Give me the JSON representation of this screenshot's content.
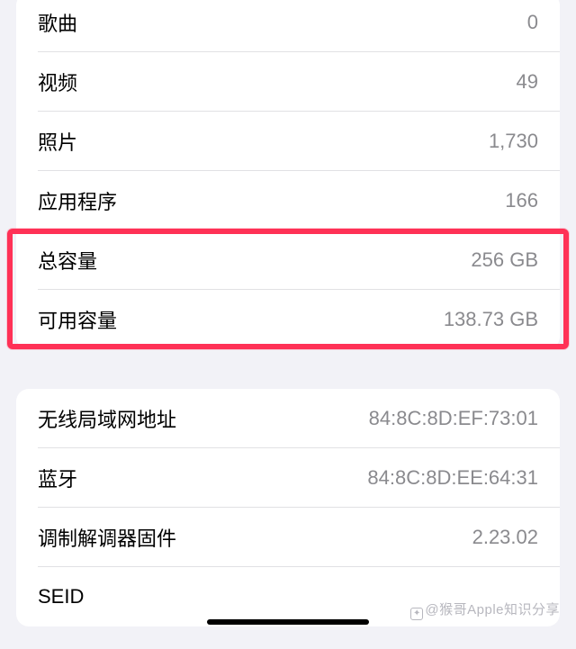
{
  "section1": {
    "songs": {
      "label": "歌曲",
      "value": "0"
    },
    "videos": {
      "label": "视频",
      "value": "49"
    },
    "photos": {
      "label": "照片",
      "value": "1,730"
    },
    "apps": {
      "label": "应用程序",
      "value": "166"
    },
    "total_capacity": {
      "label": "总容量",
      "value": "256 GB"
    },
    "available_capacity": {
      "label": "可用容量",
      "value": "138.73 GB"
    }
  },
  "section2": {
    "wifi_address": {
      "label": "无线局域网地址",
      "value": "84:8C:8D:EF:73:01"
    },
    "bluetooth": {
      "label": "蓝牙",
      "value": "84:8C:8D:EE:64:31"
    },
    "modem_firmware": {
      "label": "调制解调器固件",
      "value": "2.23.02"
    },
    "seid": {
      "label": "SEID",
      "value": ""
    }
  },
  "watermark": "@猴哥Apple知识分享"
}
